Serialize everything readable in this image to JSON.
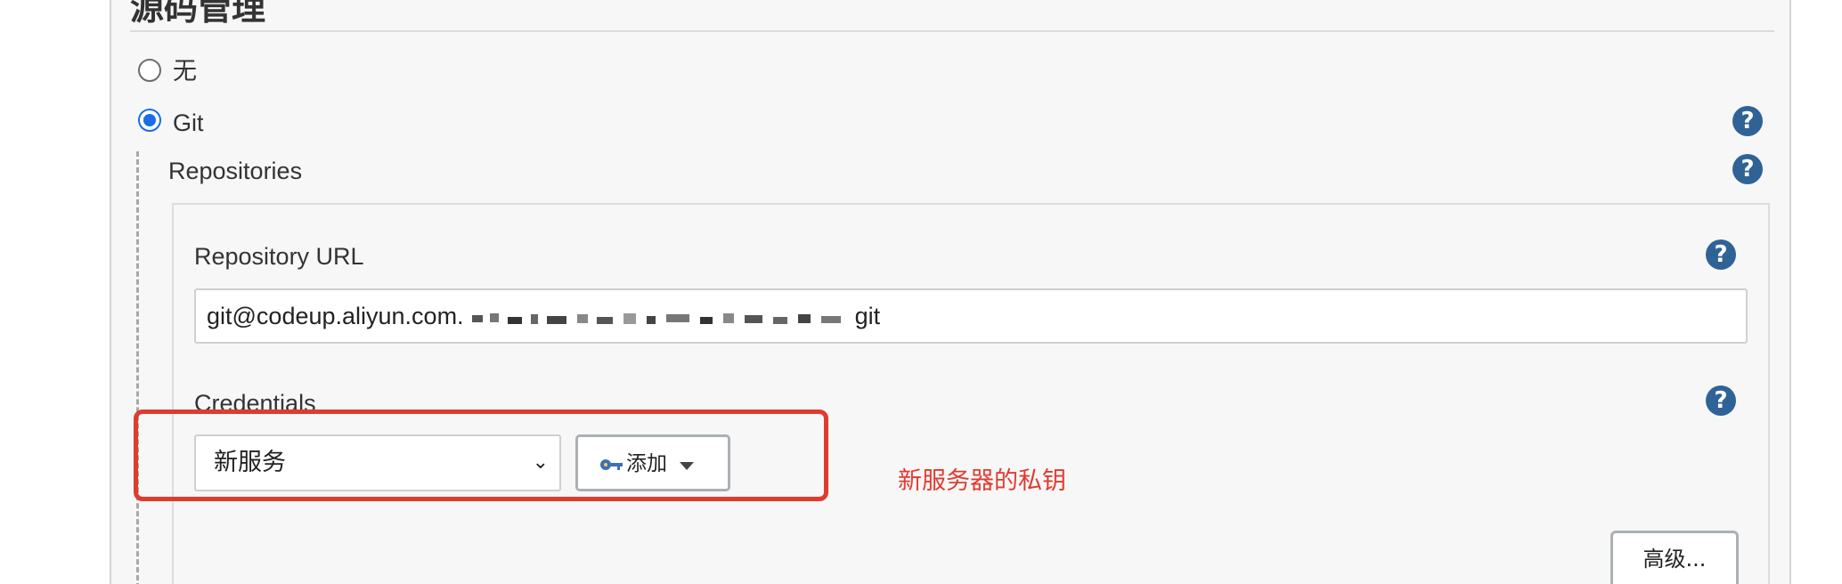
{
  "scm": {
    "title": "源码管理",
    "options": [
      {
        "label": "无",
        "checked": false
      },
      {
        "label": "Git",
        "checked": true
      }
    ],
    "help_glyph": "?"
  },
  "repositories": {
    "label": "Repositories",
    "repository_url": {
      "label": "Repository URL",
      "value_visible_prefix": "git@codeup.aliyun.com.",
      "value_visible_suffix": "git",
      "redacted": true
    },
    "credentials": {
      "label": "Credentials",
      "selected": "新服务",
      "add_button_label": "添加",
      "add_button_icon": "key-icon"
    },
    "advanced_button_label": "高级..."
  },
  "annotation": {
    "text": "新服务器的私钥",
    "color": "#e03b2f"
  },
  "colors": {
    "accent": "#1a6ce8",
    "help": "#2f6396",
    "highlight": "#e03b2f",
    "panel_bg": "#f7f7f7"
  }
}
